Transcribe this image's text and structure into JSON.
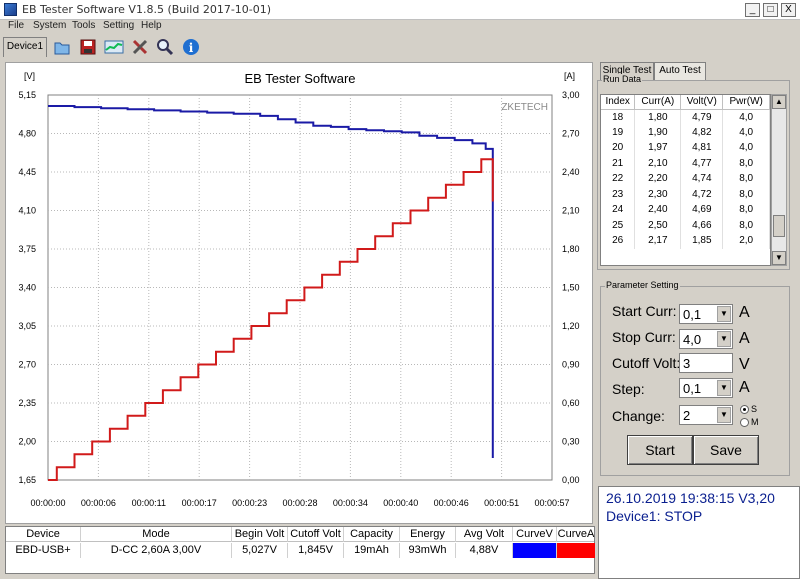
{
  "window": {
    "title": "EB Tester Software V1.8.5 (Build 2017-10-01)",
    "buttons": {
      "minimize": "_",
      "maximize": "□",
      "close": "X"
    }
  },
  "menu": [
    "File",
    "System",
    "Tools",
    "Setting",
    "Help"
  ],
  "toolbar": {
    "device_tab": "Device1",
    "icons": [
      "folder-icon",
      "save-icon",
      "chart-icon",
      "tools-icon",
      "magnifier-icon",
      "info-icon"
    ]
  },
  "chart_data": {
    "type": "line",
    "title": "EB Tester Software",
    "watermark": "ZKETECH",
    "left_unit": "[V]",
    "right_unit": "[A]",
    "left_ticks": [
      "5,15",
      "4,80",
      "4,45",
      "4,10",
      "3,75",
      "3,40",
      "3,05",
      "2,70",
      "2,35",
      "2,00",
      "1,65"
    ],
    "right_ticks": [
      "3,00",
      "2,70",
      "2,40",
      "2,10",
      "1,80",
      "1,50",
      "1,20",
      "0,90",
      "0,60",
      "0,30",
      "0,00"
    ],
    "x_ticks": [
      "00:00:00",
      "00:00:06",
      "00:00:11",
      "00:00:17",
      "00:00:23",
      "00:00:28",
      "00:00:34",
      "00:00:40",
      "00:00:46",
      "00:00:51",
      "00:00:57"
    ],
    "ylim_left": [
      1.65,
      5.15
    ],
    "ylim_right": [
      0.0,
      3.0
    ],
    "xlim": [
      0,
      57
    ],
    "grid": true,
    "series": [
      {
        "color": "#1a1aa6",
        "axis": "left",
        "points": [
          [
            0,
            5.05
          ],
          [
            3,
            5.04
          ],
          [
            6,
            5.03
          ],
          [
            9,
            5.02
          ],
          [
            12,
            5.01
          ],
          [
            15,
            5.0
          ],
          [
            18,
            4.99
          ],
          [
            21,
            4.98
          ],
          [
            24,
            4.96
          ],
          [
            26,
            4.93
          ],
          [
            28,
            4.9
          ],
          [
            30,
            4.87
          ],
          [
            32,
            4.86
          ],
          [
            34,
            4.84
          ],
          [
            36,
            4.83
          ],
          [
            38,
            4.82
          ],
          [
            40,
            4.81
          ],
          [
            42,
            4.78
          ],
          [
            44,
            4.76
          ],
          [
            46,
            4.74
          ],
          [
            48,
            4.71
          ],
          [
            49.5,
            4.66
          ],
          [
            50.3,
            4.64
          ],
          [
            50.3,
            1.85
          ]
        ]
      },
      {
        "color": "#d11a1a",
        "axis": "right",
        "points": [
          [
            0,
            0.0
          ],
          [
            1,
            0.1
          ],
          [
            3,
            0.2
          ],
          [
            5,
            0.3
          ],
          [
            7,
            0.4
          ],
          [
            9,
            0.5
          ],
          [
            11,
            0.6
          ],
          [
            13,
            0.7
          ],
          [
            15,
            0.8
          ],
          [
            17,
            0.9
          ],
          [
            19,
            1.0
          ],
          [
            21,
            1.1
          ],
          [
            23,
            1.2
          ],
          [
            25,
            1.3
          ],
          [
            27,
            1.4
          ],
          [
            29,
            1.5
          ],
          [
            31,
            1.6
          ],
          [
            33,
            1.7
          ],
          [
            35,
            1.8
          ],
          [
            37,
            1.9
          ],
          [
            39,
            2.0
          ],
          [
            41,
            2.1
          ],
          [
            43,
            2.2
          ],
          [
            45,
            2.3
          ],
          [
            47,
            2.4
          ],
          [
            49,
            2.5
          ],
          [
            50.3,
            2.5
          ],
          [
            50.3,
            2.17
          ]
        ]
      }
    ]
  },
  "right_tabs": [
    "Single Test",
    "Auto Test"
  ],
  "run_data": {
    "label": "Run Data",
    "columns": [
      "Index",
      "Curr(A)",
      "Volt(V)",
      "Pwr(W)"
    ],
    "rows": [
      [
        "18",
        "1,80",
        "4,79",
        "4,0"
      ],
      [
        "19",
        "1,90",
        "4,82",
        "4,0"
      ],
      [
        "20",
        "1,97",
        "4,81",
        "4,0"
      ],
      [
        "21",
        "2,10",
        "4,77",
        "8,0"
      ],
      [
        "22",
        "2,20",
        "4,74",
        "8,0"
      ],
      [
        "23",
        "2,30",
        "4,72",
        "8,0"
      ],
      [
        "24",
        "2,40",
        "4,69",
        "8,0"
      ],
      [
        "25",
        "2,50",
        "4,66",
        "8,0"
      ],
      [
        "26",
        "2,17",
        "1,85",
        "2,0"
      ]
    ]
  },
  "params": {
    "label": "Parameter Setting",
    "start_curr_label": "Start Curr:",
    "start_curr_value": "0,1",
    "start_curr_unit": "A",
    "stop_curr_label": "Stop Curr:",
    "stop_curr_value": "4,0",
    "stop_curr_unit": "A",
    "cutoff_label": "Cutoff Volt:",
    "cutoff_value": "3",
    "cutoff_unit": "V",
    "step_label": "Step:",
    "step_value": "0,1",
    "step_unit": "A",
    "change_label": "Change:",
    "change_value": "2",
    "radio_s": "S",
    "radio_m": "M",
    "start_button": "Start",
    "save_button": "Save"
  },
  "status": {
    "line1": "26.10.2019 19:38:15  V3,20",
    "line2": "Device1: STOP"
  },
  "device_table": {
    "headers": [
      "Device",
      "Mode",
      "Begin Volt",
      "Cutoff Volt",
      "Capacity",
      "Energy",
      "Avg Volt",
      "CurveV",
      "CurveA"
    ],
    "row": [
      "EBD-USB+",
      "D-CC  2,60A  3,00V",
      "5,027V",
      "1,845V",
      "19mAh",
      "93mWh",
      "4,88V",
      "",
      ""
    ],
    "curve_v_color": "#0000ff",
    "curve_a_color": "#ff0000"
  }
}
